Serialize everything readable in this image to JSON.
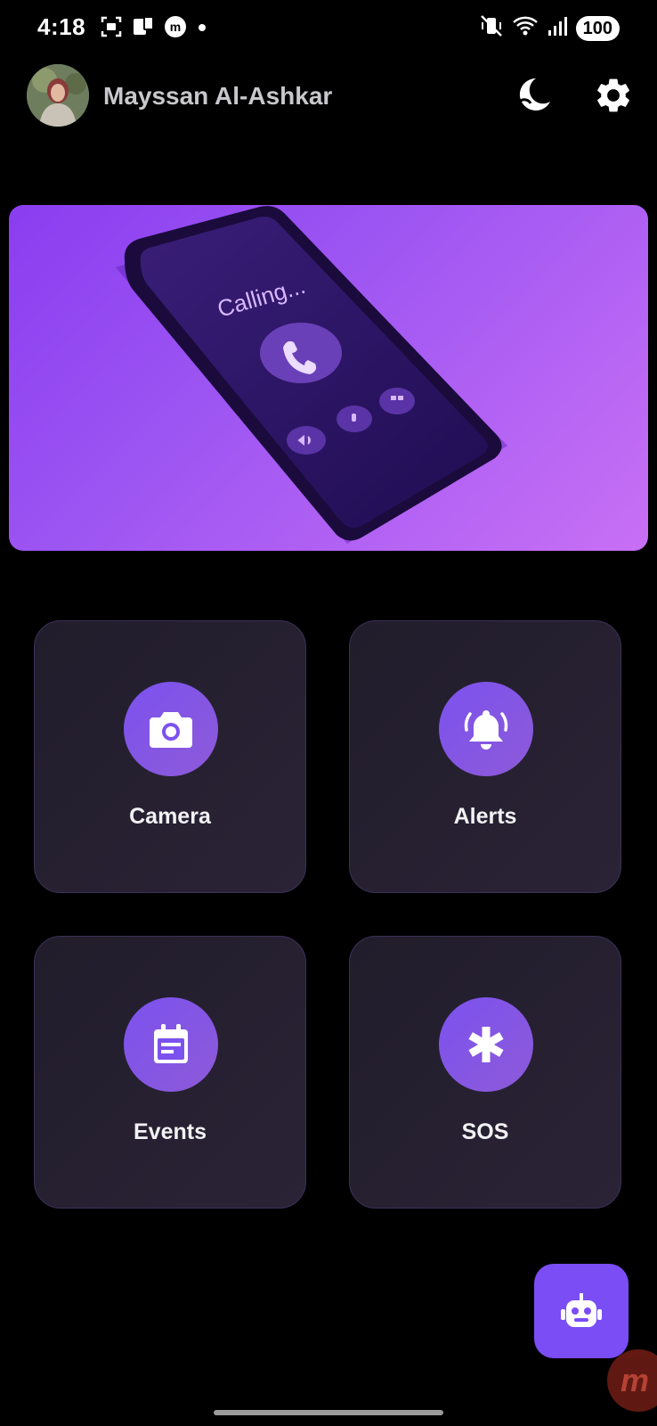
{
  "status_bar": {
    "time": "4:18",
    "battery": "100",
    "icons": [
      "screenshot-icon",
      "cast-icon",
      "app-m-icon",
      "notification-dot-icon",
      "vibrate-icon",
      "wifi-icon",
      "signal-icon"
    ]
  },
  "header": {
    "user_name": "Mayssan Al-Ashkar",
    "avatar_icon": "avatar-photo",
    "theme_icon": "moon-icon",
    "settings_icon": "gear-icon"
  },
  "banner": {
    "calling_text": "Calling...",
    "icons": [
      "phone-icon",
      "speaker-icon",
      "mic-icon",
      "keypad-icon"
    ]
  },
  "tiles": [
    {
      "label": "Camera",
      "icon": "camera-icon"
    },
    {
      "label": "Alerts",
      "icon": "bell-icon"
    },
    {
      "label": "Events",
      "icon": "calendar-icon"
    },
    {
      "label": "SOS",
      "icon": "asterisk-icon"
    }
  ],
  "fab": {
    "icon": "robot-icon"
  },
  "colors": {
    "accent": "#7a4df5",
    "tile_bg": "#241f2f",
    "tile_border": "#3b3158",
    "banner_start": "#8a3df0",
    "banner_end": "#c870f5"
  }
}
